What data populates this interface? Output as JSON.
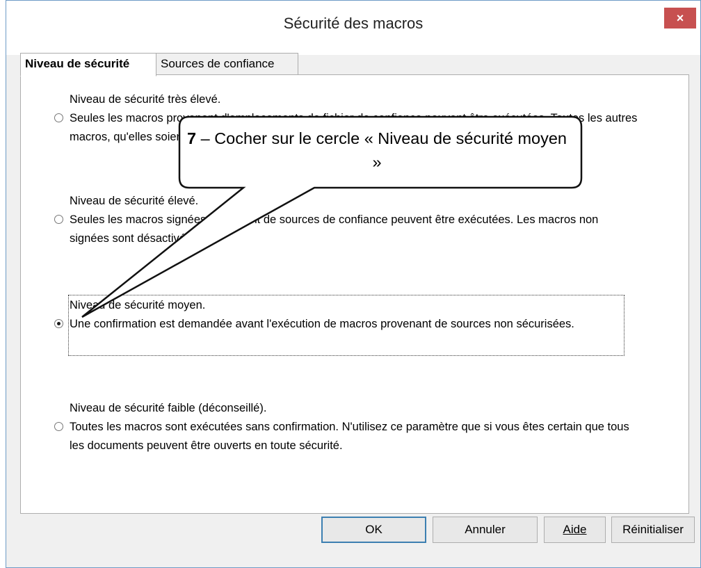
{
  "dialog": {
    "title": "Sécurité des macros",
    "close_label": "×"
  },
  "tabs": [
    {
      "label": "Niveau de sécurité",
      "active": true
    },
    {
      "label": "Sources de confiance",
      "active": false
    }
  ],
  "options": [
    {
      "heading": "Niveau de sécurité très élevé.",
      "description": "Seules les macros provenant d'emplacements de fichier de confiance peuvent être exécutées. Toutes les autres macros, qu'elles soient signées ou non, sont désactivées.",
      "selected": false
    },
    {
      "heading": "Niveau de sécurité élevé.",
      "description": "Seules les macros signées provenant de sources de confiance peuvent être exécutées. Les macros non signées sont désactivées.",
      "selected": false
    },
    {
      "heading": "Niveau de sécurité moyen.",
      "description": "Une confirmation est demandée avant l'exécution de macros provenant de sources non sécurisées.",
      "selected": true
    },
    {
      "heading": "Niveau de sécurité faible (déconseillé).",
      "description": "Toutes les macros sont exécutées sans confirmation. N'utilisez ce paramètre que si vous êtes certain que tous les documents peuvent être ouverts en toute sécurité.",
      "selected": false
    }
  ],
  "buttons": {
    "ok": "OK",
    "cancel": "Annuler",
    "help": "Aide",
    "reset": "Réinitialiser"
  },
  "callout": {
    "step": "7",
    "text": " – Cocher sur le cercle « Niveau de sécurité moyen »"
  }
}
